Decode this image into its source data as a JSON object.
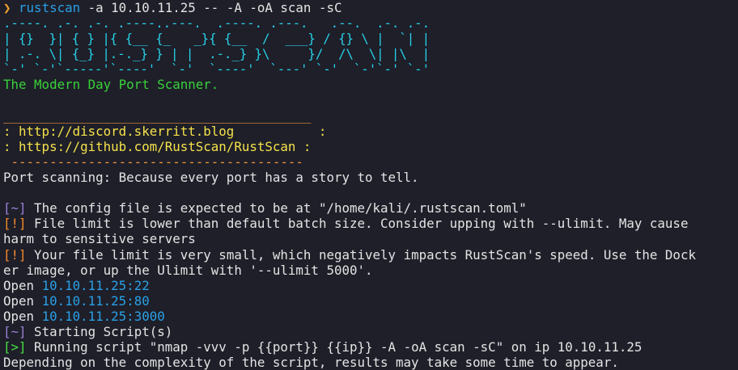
{
  "command": {
    "prompt_symbol": "❯",
    "program": "rustscan",
    "arguments": " -a 10.10.11.25 -- -A -oA scan -sC"
  },
  "banner": {
    "lines": [
      ".----. .-. .-. .----..---.  .----. .---.   .--.  .-. .-.",
      "| {}  }| { } |{ {__ {_   _}{ {__  /  ___} / {} \\ |  `| |",
      "| .-. \\| {_} |.-._} } | |  .-._} }\\     }/  /\\  \\| |\\  |",
      "`-' `-'`-----'`----'  `-'  `----'  `---' `-'  `-'`-' `-'"
    ],
    "tagline": "The Modern Day Port Scanner."
  },
  "links_box": {
    "top_rule": "________________________________________",
    "discord": ": http://discord.skerritt.blog           :",
    "github": ": https://github.com/RustScan/RustScan :",
    "bottom_rule": " --------------------------------------"
  },
  "motto": "Port scanning: Because every port has a story to tell.",
  "messages": [
    {
      "marker": "[~]",
      "kind": "info",
      "text": " The config file is expected to be at \"/home/kali/.rustscan.toml\""
    },
    {
      "marker": "[!]",
      "kind": "warn",
      "text": " File limit is lower than default batch size. Consider upping with --ulimit. May cause"
    },
    {
      "marker": "",
      "kind": "cont",
      "text": "harm to sensitive servers"
    },
    {
      "marker": "[!]",
      "kind": "warn",
      "text": " Your file limit is very small, which negatively impacts RustScan's speed. Use the Dock"
    },
    {
      "marker": "",
      "kind": "cont",
      "text": "er image, or up the Ulimit with '--ulimit 5000'."
    }
  ],
  "open_ports": [
    {
      "label": "Open ",
      "address": "10.10.11.25:22"
    },
    {
      "label": "Open ",
      "address": "10.10.11.25:80"
    },
    {
      "label": "Open ",
      "address": "10.10.11.25:3000"
    }
  ],
  "script_lines": [
    {
      "marker": "[~]",
      "kind": "info",
      "text": " Starting Script(s)"
    },
    {
      "marker": "[>]",
      "kind": "run",
      "text": " Running script \"nmap -vvv -p {{port}} {{ip}} -A -oA scan -sC\" on ip 10.10.11.25"
    }
  ],
  "footer": "Depending on the complexity of the script, results may take some time to appear."
}
